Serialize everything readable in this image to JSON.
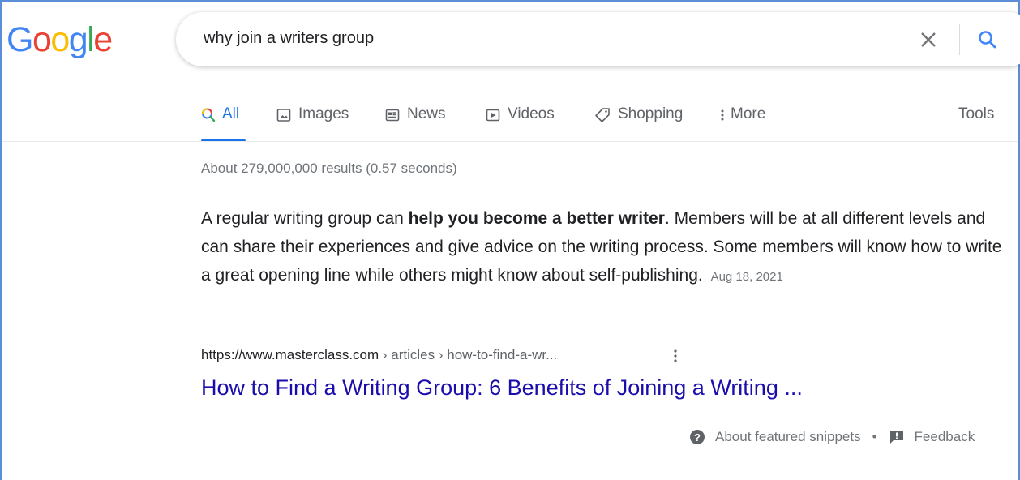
{
  "logo": {
    "letters": [
      "G",
      "o",
      "o",
      "g",
      "l",
      "e"
    ],
    "colors": {
      "blue": "#4285f4",
      "red": "#ea4335",
      "yellow": "#fbbc05",
      "green": "#34a853"
    }
  },
  "search": {
    "query": "why join a writers group",
    "clear_icon": "close-icon",
    "search_icon": "search-icon"
  },
  "tabs": [
    {
      "label": "All",
      "icon": "search-icon",
      "active": true
    },
    {
      "label": "Images",
      "icon": "image-icon",
      "active": false
    },
    {
      "label": "News",
      "icon": "newspaper-icon",
      "active": false
    },
    {
      "label": "Videos",
      "icon": "play-icon",
      "active": false
    },
    {
      "label": "Shopping",
      "icon": "tag-icon",
      "active": false
    },
    {
      "label": "More",
      "icon": "vertical-dots-icon",
      "active": false
    }
  ],
  "tools_label": "Tools",
  "result_stats": "About 279,000,000 results (0.57 seconds)",
  "featured_snippet": {
    "text_before": "A regular writing group can ",
    "bold": "help you become a better writer",
    "text_after": ". Members will be at all different levels and can share their experiences and give advice on the writing process. Some members will know how to write a great opening line while others might know about self-publishing.",
    "date": "Aug 18, 2021"
  },
  "source": {
    "url": "https://www.masterclass.com",
    "breadcrumb": " › articles › how-to-find-a-wr...",
    "title": "How to Find a Writing Group: 6 Benefits of Joining a Writing ..."
  },
  "footer": {
    "about_label": "About featured snippets",
    "separator": "•",
    "feedback_label": "Feedback"
  },
  "colors": {
    "accent": "#1a73e8",
    "link": "#1a0dab",
    "secondary_text": "#70757a"
  }
}
